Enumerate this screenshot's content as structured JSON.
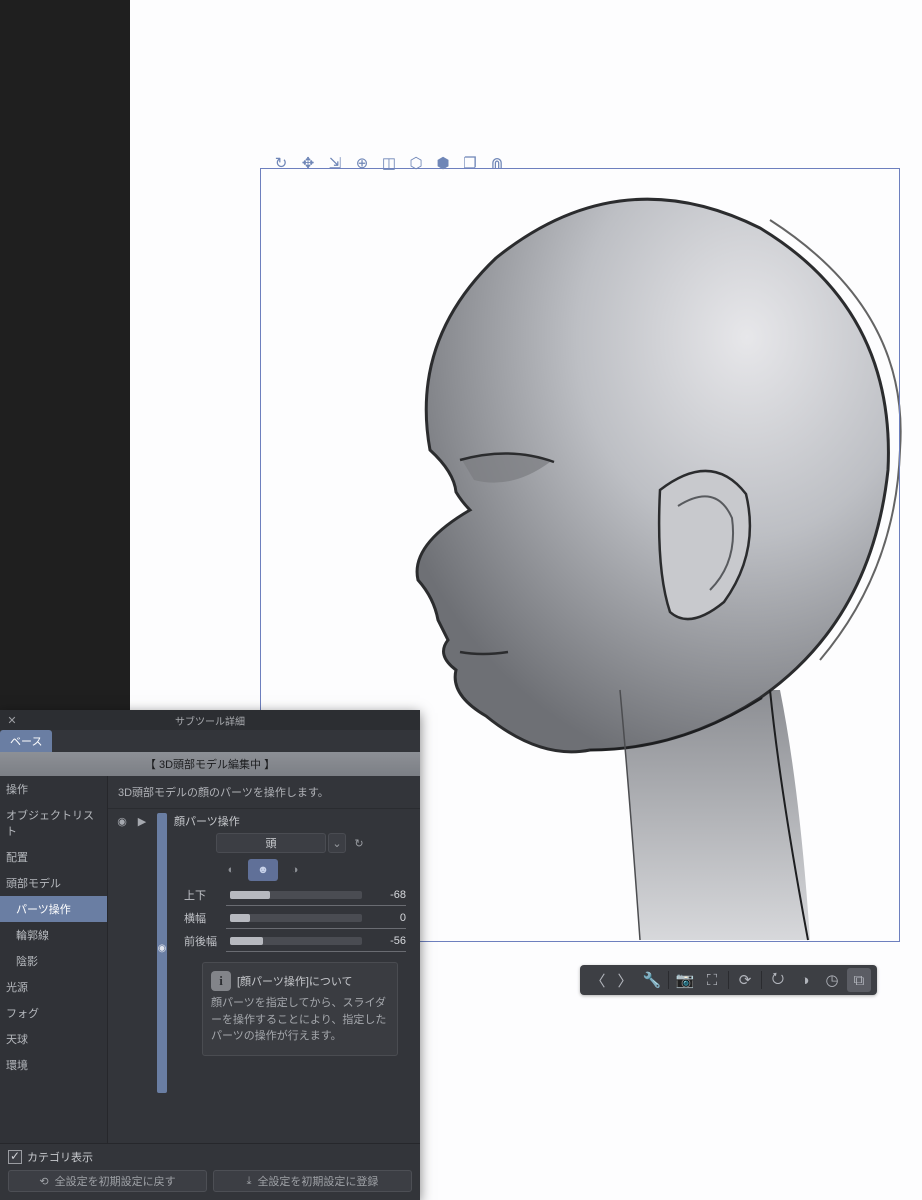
{
  "panel": {
    "title": "サブツール詳細",
    "tab": "ベース",
    "subtitle": "【 3D頭部モデル編集中 】",
    "description": "3D頭部モデルの顔のパーツを操作します。",
    "categories": [
      {
        "label": "操作",
        "child": false
      },
      {
        "label": "オブジェクトリスト",
        "child": false
      },
      {
        "label": "配置",
        "child": false
      },
      {
        "label": "頭部モデル",
        "child": false
      },
      {
        "label": "パーツ操作",
        "child": true,
        "selected": true
      },
      {
        "label": "輪郭線",
        "child": true
      },
      {
        "label": "陰影",
        "child": true
      },
      {
        "label": "光源",
        "child": false
      },
      {
        "label": "フォグ",
        "child": false
      },
      {
        "label": "天球",
        "child": false
      },
      {
        "label": "環境",
        "child": false
      }
    ],
    "group_title": "顔パーツ操作",
    "dropdown_value": "頭",
    "sliders": [
      {
        "label": "上下",
        "value": -68,
        "fill_pct": 30
      },
      {
        "label": "横幅",
        "value": 0,
        "fill_pct": 15
      },
      {
        "label": "前後幅",
        "value": -56,
        "fill_pct": 25
      }
    ],
    "info_title": "[顔パーツ操作]について",
    "info_body": "顔パーツを指定してから、スライダーを操作することにより、指定したパーツの操作が行えます。",
    "show_category_label": "カテゴリ表示",
    "reset_all": "全設定を初期設定に戻す",
    "register_all": "全設定を初期設定に登録"
  },
  "manip_icons": [
    "orbit",
    "move-3d",
    "scale-3d",
    "pivot",
    "cube-wire",
    "cube-up",
    "cube-axes",
    "box-stack",
    "magnet"
  ],
  "view_icons": [
    "prev",
    "next",
    "wrench",
    "camera",
    "focus",
    "cube-rot",
    "rot-add",
    "cube-cycle",
    "timer",
    "layers-add"
  ]
}
